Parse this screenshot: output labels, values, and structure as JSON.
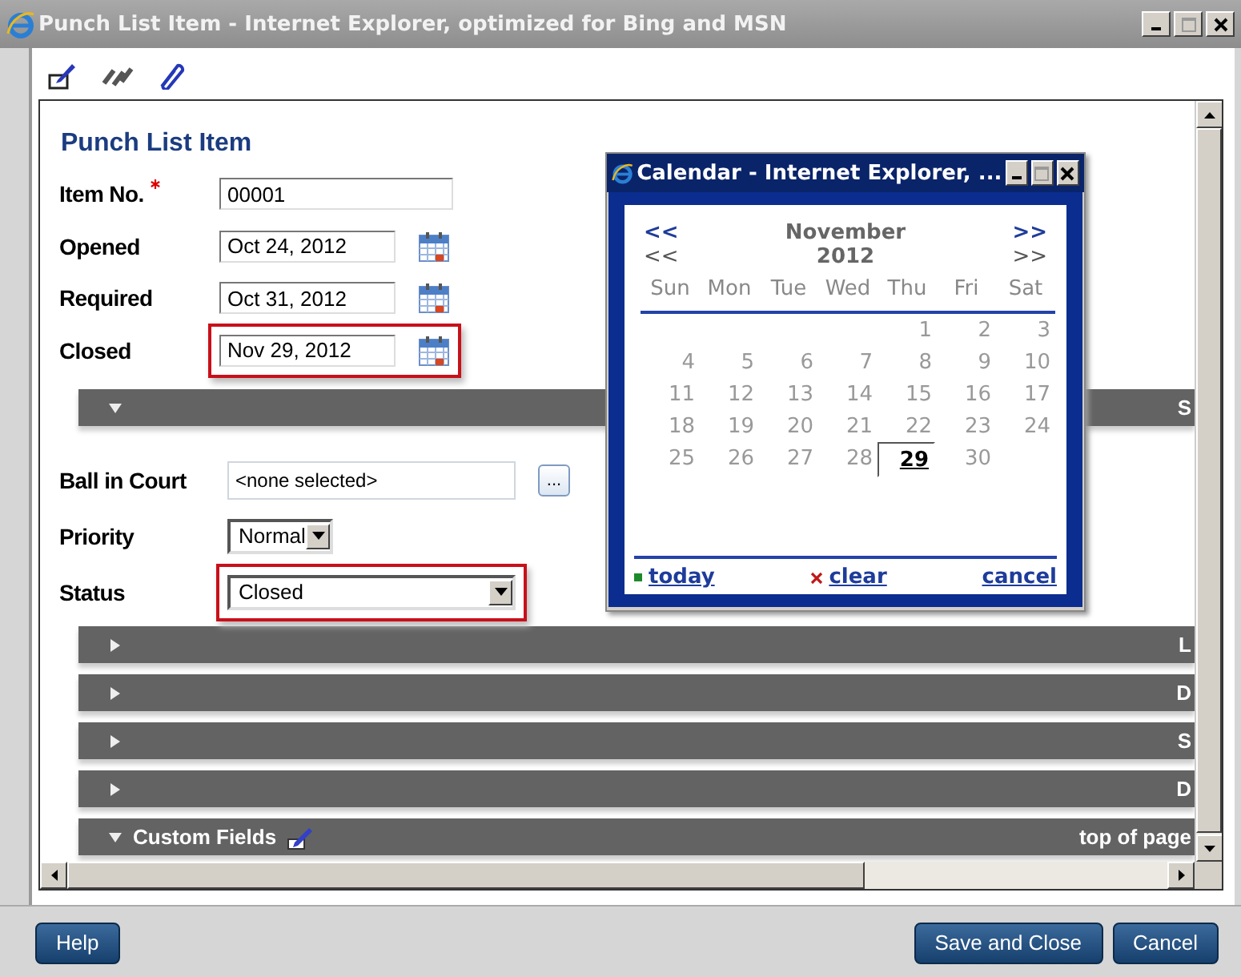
{
  "window": {
    "title": "Punch List Item - Internet Explorer, optimized for Bing and MSN"
  },
  "form": {
    "title": "Punch List Item",
    "fields": [
      {
        "kind": "text",
        "label": "Item No.",
        "required": true,
        "value": "00001",
        "highlighted": false
      },
      {
        "kind": "date",
        "label": "Opened",
        "required": false,
        "value": "Oct 24, 2012",
        "highlighted": false
      },
      {
        "kind": "date",
        "label": "Required",
        "required": false,
        "value": "Oct 31, 2012",
        "highlighted": false
      },
      {
        "kind": "date",
        "label": "Closed",
        "required": false,
        "value": "Nov 29, 2012",
        "highlighted": true
      }
    ],
    "more_fields": [
      {
        "kind": "picker",
        "label": "Ball in Court",
        "value": "<none selected>",
        "button": "...",
        "highlighted": false
      },
      {
        "kind": "select",
        "label": "Priority",
        "value": "Normal",
        "highlighted": false
      },
      {
        "kind": "wideselect",
        "label": "Status",
        "value": "Closed",
        "highlighted": true
      }
    ]
  },
  "sections": [
    {
      "expanded": true,
      "right_text": "S"
    },
    {
      "expanded": false,
      "right_text": "L"
    },
    {
      "expanded": false,
      "right_text": "D"
    },
    {
      "expanded": false,
      "right_text": "S"
    },
    {
      "expanded": false,
      "right_text": "D"
    },
    {
      "label": "Custom Fields",
      "expanded": true,
      "right_text": "top of page"
    }
  ],
  "calendar": {
    "title": "Calendar - Internet Explorer, ...",
    "month": "November",
    "year": "2012",
    "prev": "<<",
    "next": ">>",
    "prev_year": "<<",
    "next_year": ">>",
    "weekdays": [
      "Sun",
      "Mon",
      "Tue",
      "Wed",
      "Thu",
      "Fri",
      "Sat"
    ],
    "weeks": [
      [
        {
          "day": "1",
          "selected": false
        },
        {
          "day": "2",
          "selected": false
        },
        {
          "day": "3",
          "selected": false
        }
      ],
      [
        {
          "day": "4",
          "selected": false
        },
        {
          "day": "5",
          "selected": false
        },
        {
          "day": "6",
          "selected": false
        },
        {
          "day": "7",
          "selected": false
        },
        {
          "day": "8",
          "selected": false
        },
        {
          "day": "9",
          "selected": false
        },
        {
          "day": "10",
          "selected": false
        }
      ],
      [
        {
          "day": "11",
          "selected": false
        },
        {
          "day": "12",
          "selected": false
        },
        {
          "day": "13",
          "selected": false
        },
        {
          "day": "14",
          "selected": false
        },
        {
          "day": "15",
          "selected": false
        },
        {
          "day": "16",
          "selected": false
        },
        {
          "day": "17",
          "selected": false
        }
      ],
      [
        {
          "day": "18",
          "selected": false
        },
        {
          "day": "19",
          "selected": false
        },
        {
          "day": "20",
          "selected": false
        },
        {
          "day": "21",
          "selected": false
        },
        {
          "day": "22",
          "selected": false
        },
        {
          "day": "23",
          "selected": false
        },
        {
          "day": "24",
          "selected": false
        }
      ],
      [
        {
          "day": "25",
          "selected": false
        },
        {
          "day": "26",
          "selected": false
        },
        {
          "day": "27",
          "selected": false
        },
        {
          "day": "28",
          "selected": false
        },
        {
          "day": "29",
          "selected": true
        },
        {
          "day": "30",
          "selected": false
        }
      ]
    ],
    "links": [
      {
        "kind": "today",
        "label": "today"
      },
      {
        "kind": "clear",
        "label": "clear"
      },
      {
        "kind": "cancel",
        "label": "cancel"
      }
    ]
  },
  "buttons": [
    {
      "kind": "left",
      "label": "Help"
    },
    {
      "kind": "right",
      "label": "Save and Close"
    },
    {
      "kind": "right",
      "label": "Cancel"
    }
  ]
}
